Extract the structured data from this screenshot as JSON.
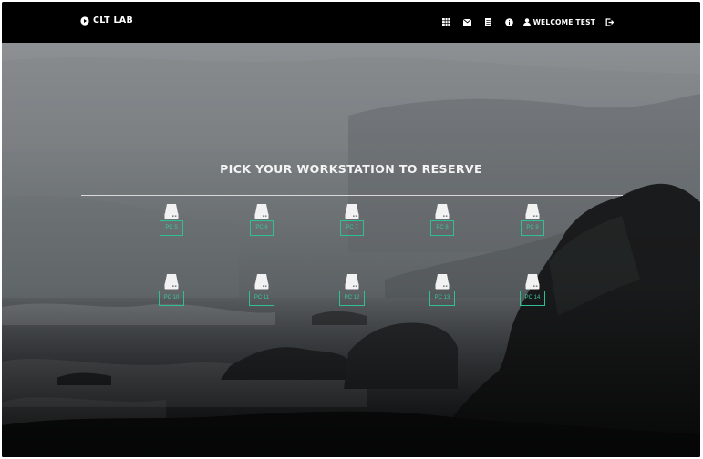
{
  "nav": {
    "brand": "CLT LAB",
    "icons": [
      "table-icon",
      "envelope-icon",
      "document-icon",
      "info-icon",
      "user-icon",
      "logout-icon"
    ],
    "user_label": "WELCOME TEST"
  },
  "main": {
    "heading": "PICK YOUR WORKSTATION TO RESERVE",
    "workstations": [
      {
        "label": "PC 5",
        "icon": "hard-drive-icon"
      },
      {
        "label": "PC 6",
        "icon": "hard-drive-icon"
      },
      {
        "label": "PC 7",
        "icon": "hard-drive-icon"
      },
      {
        "label": "PC 8",
        "icon": "hard-drive-icon"
      },
      {
        "label": "PC 9",
        "icon": "hard-drive-icon"
      },
      {
        "label": "PC 10",
        "icon": "hard-drive-icon"
      },
      {
        "label": "PC 11",
        "icon": "hard-drive-icon"
      },
      {
        "label": "PC 12",
        "icon": "hard-drive-icon"
      },
      {
        "label": "PC 13",
        "icon": "hard-drive-icon"
      },
      {
        "label": "PC 14",
        "icon": "hard-drive-icon"
      }
    ]
  },
  "colors": {
    "navbar": "#000000",
    "accent": "#39c79b",
    "text": "#ffffff"
  }
}
